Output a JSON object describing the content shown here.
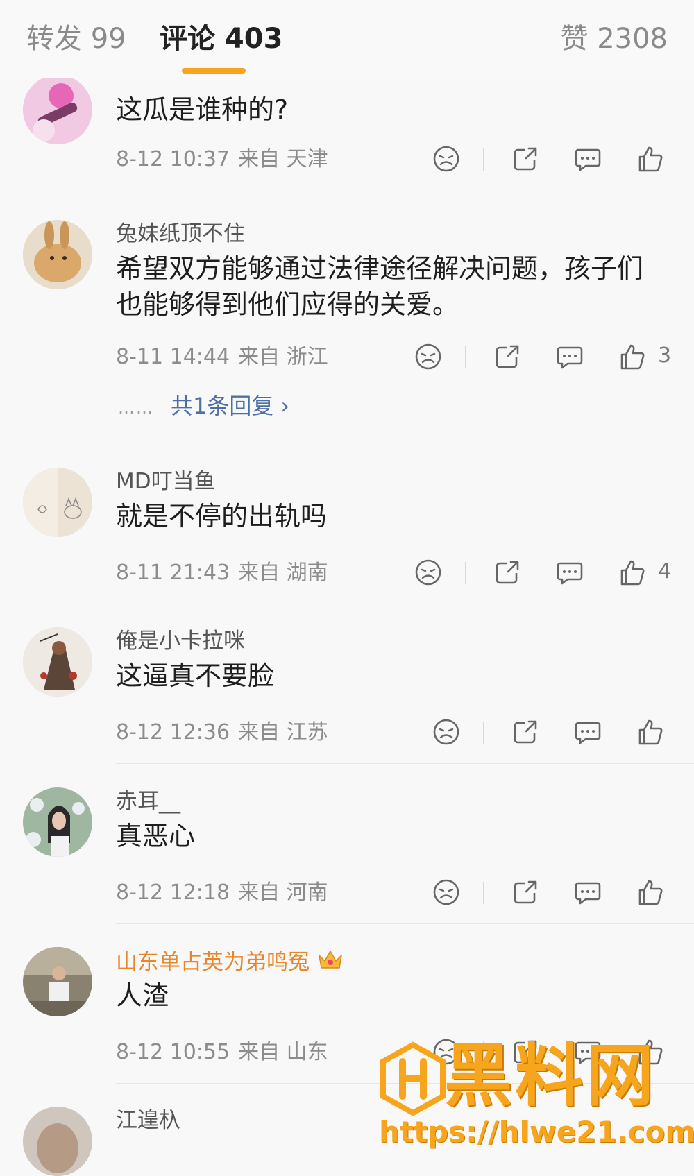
{
  "tabs": {
    "forward": "转发 99",
    "comments": "评论 403",
    "likes": "赞 2308"
  },
  "colors": {
    "accent": "#f7a51c",
    "link": "#4c6fa8",
    "vip_name": "#e8862a"
  },
  "comments": [
    {
      "username": "",
      "text": "这瓜是谁种的?",
      "time": "8-12 10:37",
      "location": "来自 天津",
      "likes": ""
    },
    {
      "username": "兔妹纸顶不住",
      "text": "希望双方能够通过法律途径解决问题，孩子们也能够得到他们应得的关爱。",
      "time": "8-11 14:44",
      "location": "来自 浙江",
      "likes": "3",
      "replies_label": "共1条回复",
      "replies_dots": "……"
    },
    {
      "username": "MD叮当鱼",
      "text": "就是不停的出轨吗",
      "time": "8-11 21:43",
      "location": "来自 湖南",
      "likes": "4"
    },
    {
      "username": "俺是小卡拉咪",
      "text": "这逼真不要脸",
      "time": "8-12 12:36",
      "location": "来自 江苏",
      "likes": ""
    },
    {
      "username": "赤耳__",
      "text": "真恶心",
      "time": "8-12 12:18",
      "location": "来自 河南",
      "likes": ""
    },
    {
      "username": "山东单占英为弟鸣冤",
      "text": "人渣",
      "time": "8-12 10:55",
      "location": "来自 山东",
      "likes": ""
    },
    {
      "username": "江遑杁",
      "text": "",
      "time": "",
      "location": "",
      "likes": ""
    }
  ],
  "icons": [
    "dislike-icon",
    "share-icon",
    "reply-icon",
    "like-icon",
    "crown-badge-icon"
  ],
  "watermark": {
    "brand": "黑料网",
    "url": "https://hlwe21.com"
  }
}
